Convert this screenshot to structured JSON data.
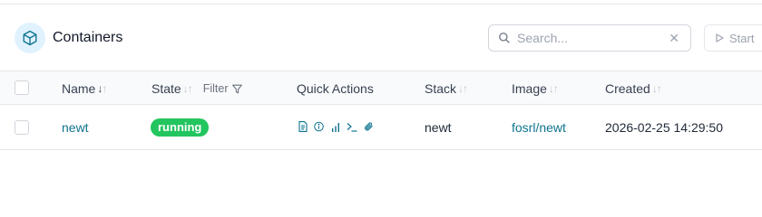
{
  "header": {
    "title": "Containers",
    "title_icon": "cube-icon",
    "search": {
      "placeholder": "Search...",
      "value": ""
    },
    "start_label": "Start"
  },
  "table": {
    "columns": {
      "name": "Name",
      "state": "State",
      "state_filter": "Filter",
      "quick_actions": "Quick Actions",
      "stack": "Stack",
      "image": "Image",
      "created": "Created"
    },
    "sort": {
      "column": "Name",
      "direction": "desc"
    },
    "rows": [
      {
        "name": "newt",
        "state": "running",
        "quick_actions": [
          "logs-icon",
          "inspect-icon",
          "stats-icon",
          "console-icon",
          "attach-icon"
        ],
        "stack": "newt",
        "image": "fosrl/newt",
        "created": "2026-02-25 14:29:50"
      }
    ]
  },
  "colors": {
    "accent": "#0e7490",
    "running": "#22c55e",
    "icon_bg": "#e0f2fe"
  }
}
